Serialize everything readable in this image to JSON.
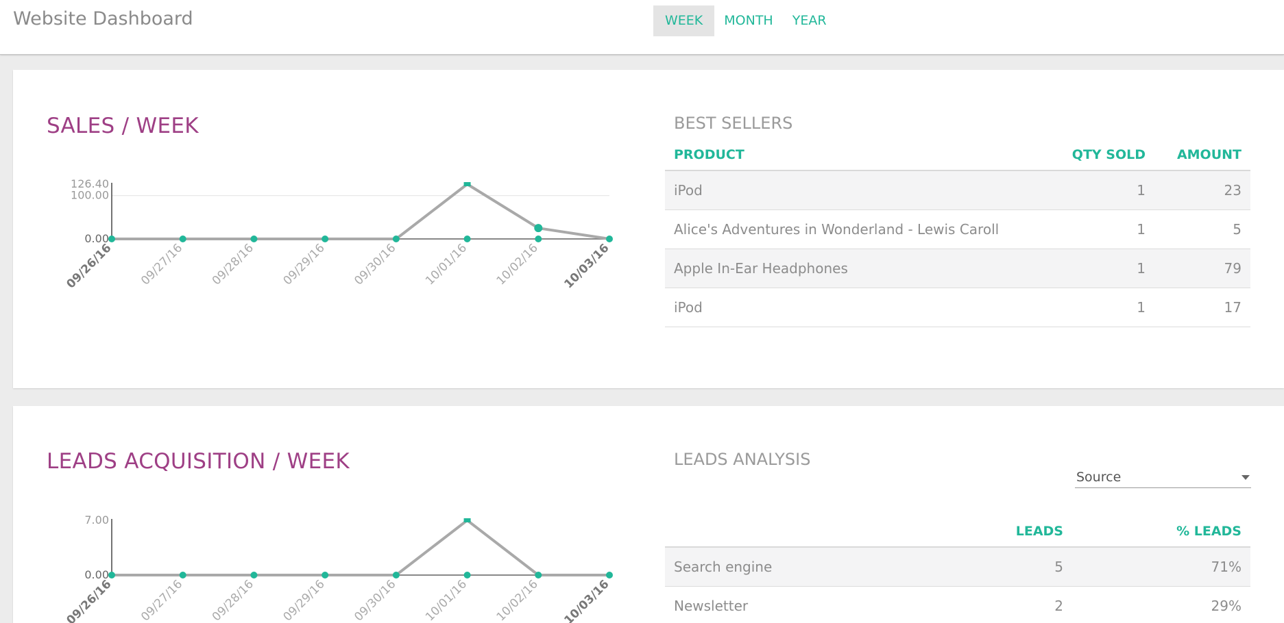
{
  "header": {
    "title": "Website Dashboard",
    "ranges": [
      {
        "label": "WEEK",
        "active": true
      },
      {
        "label": "MONTH",
        "active": false
      },
      {
        "label": "YEAR",
        "active": false
      }
    ]
  },
  "colors": {
    "accent": "#21b799",
    "title": "#9e3f85",
    "line": "#a9a9a9"
  },
  "sales": {
    "title": "SALES / WEEK",
    "best_sellers": {
      "title": "BEST SELLERS",
      "columns": [
        "PRODUCT",
        "QTY SOLD",
        "AMOUNT"
      ],
      "rows": [
        [
          "iPod",
          "1",
          "23"
        ],
        [
          "Alice's Adventures in Wonderland - Lewis Caroll",
          "1",
          "5"
        ],
        [
          "Apple In-Ear Headphones",
          "1",
          "79"
        ],
        [
          "iPod",
          "1",
          "17"
        ]
      ]
    }
  },
  "leads": {
    "title": "LEADS ACQUISITION / WEEK",
    "analysis": {
      "title": "LEADS ANALYSIS",
      "group_by": "Source",
      "columns": [
        "",
        "LEADS",
        "% LEADS"
      ],
      "rows": [
        [
          "Search engine",
          "5",
          "71%"
        ],
        [
          "Newsletter",
          "2",
          "29%"
        ]
      ]
    }
  },
  "chart_data": [
    {
      "type": "line",
      "x": [
        "09/26/16",
        "09/27/16",
        "09/28/16",
        "09/29/16",
        "09/30/16",
        "10/01/16",
        "10/02/16",
        "10/03/16"
      ],
      "values": [
        0,
        0,
        0,
        0,
        0,
        126.4,
        25,
        0
      ],
      "y_ticks": [
        "0.00",
        "100.00",
        "126.40"
      ],
      "ylim": [
        0,
        126.4
      ],
      "grid": true,
      "legend": "none"
    },
    {
      "type": "line",
      "x": [
        "09/26/16",
        "09/27/16",
        "09/28/16",
        "09/29/16",
        "09/30/16",
        "10/01/16",
        "10/02/16",
        "10/03/16"
      ],
      "values": [
        0,
        0,
        0,
        0,
        0,
        7,
        0,
        0
      ],
      "y_ticks": [
        "0.00",
        "7.00"
      ],
      "ylim": [
        0,
        7
      ],
      "grid": false,
      "legend": "none"
    }
  ]
}
